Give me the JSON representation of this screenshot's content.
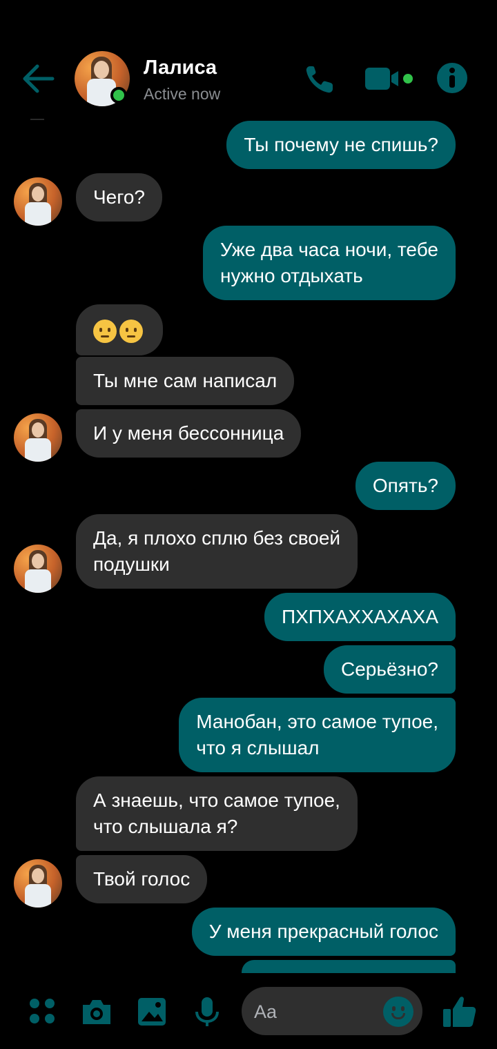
{
  "header": {
    "contact_name": "Лалиса",
    "status": "Active now",
    "online": true,
    "icons": [
      "back-arrow-icon",
      "phone-icon",
      "video-camera-icon",
      "info-icon"
    ]
  },
  "messages": [
    {
      "side": "out",
      "text": "Ты почему не спишь?"
    },
    {
      "side": "in",
      "text": "Чего?",
      "avatar": true
    },
    {
      "side": "out",
      "text": "Уже два часа ночи, тебе\nнужно отдыхать"
    },
    {
      "side": "in",
      "text": "",
      "emoji": [
        "face-with-hand-over-mouth-emoji",
        "face-with-hand-over-mouth-emoji"
      ]
    },
    {
      "side": "in",
      "text": "Ты мне сам написал"
    },
    {
      "side": "in",
      "text": "И у меня бессонница",
      "avatar": true
    },
    {
      "side": "out",
      "text": "Опять?"
    },
    {
      "side": "in",
      "text": "Да, я плохо сплю без своей\nподушки",
      "avatar": true
    },
    {
      "side": "out",
      "text": "ПХПХАХХАХАХА"
    },
    {
      "side": "out",
      "text": "Серьёзно?"
    },
    {
      "side": "out",
      "text": "Манобан, это самое тупое,\nчто я слышал"
    },
    {
      "side": "in",
      "text": "А знаешь, что самое тупое,\nчто слышала я?"
    },
    {
      "side": "in",
      "text": "Твой голос",
      "avatar": true
    },
    {
      "side": "out",
      "text": "У меня прекрасный голос"
    }
  ],
  "composer": {
    "placeholder": "Aa",
    "icons": [
      "apps-icon",
      "camera-icon",
      "gallery-icon",
      "microphone-icon",
      "emoji-icon",
      "thumbs-up-icon"
    ]
  },
  "colors": {
    "accent": "#005f66",
    "incoming_bubble": "#2f2f2f",
    "background": "#000000",
    "online": "#31c24a"
  }
}
